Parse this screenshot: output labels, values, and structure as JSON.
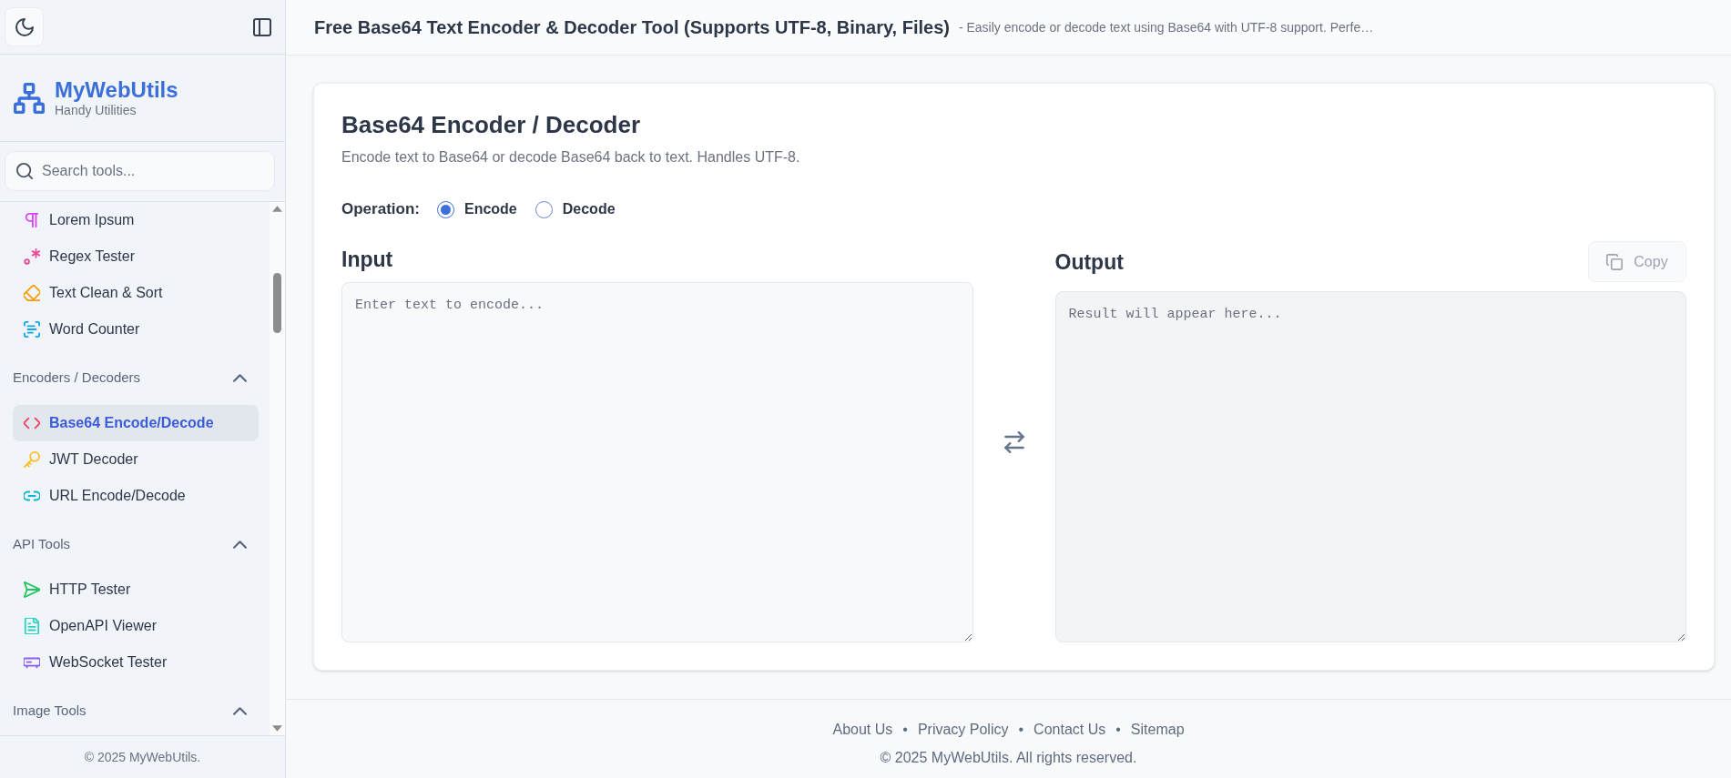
{
  "sidebar": {
    "brand": {
      "name": "MyWebUtils",
      "tagline": "Handy Utilities"
    },
    "search": {
      "placeholder": "Search tools..."
    },
    "groups": [
      {
        "items": [
          {
            "label": "Lorem Ipsum",
            "color": "#d946ef",
            "selected": false
          },
          {
            "label": "Regex Tester",
            "color": "#ec4899",
            "selected": false
          },
          {
            "label": "Text Clean & Sort",
            "color": "#f59e0b",
            "selected": false
          },
          {
            "label": "Word Counter",
            "color": "#0ea5e9",
            "selected": false
          }
        ]
      },
      {
        "title": "Encoders / Decoders",
        "expanded": true,
        "items": [
          {
            "label": "Base64 Encode/Decode",
            "color": "#f43f5e",
            "selected": true
          },
          {
            "label": "JWT Decoder",
            "color": "#fbbf24",
            "selected": false
          },
          {
            "label": "URL Encode/Decode",
            "color": "#06b6d4",
            "selected": false
          }
        ]
      },
      {
        "title": "API Tools",
        "expanded": true,
        "items": [
          {
            "label": "HTTP Tester",
            "color": "#22c55e",
            "selected": false
          },
          {
            "label": "OpenAPI Viewer",
            "color": "#2dd4bf",
            "selected": false
          },
          {
            "label": "WebSocket Tester",
            "color": "#8b5cf6",
            "selected": false
          }
        ]
      },
      {
        "title": "Image Tools",
        "expanded": true
      }
    ],
    "footer": "© 2025 MyWebUtils."
  },
  "header": {
    "title": "Free Base64 Text Encoder & Decoder Tool (Supports UTF-8, Binary, Files)",
    "subtitle": "- Easily encode or decode text using Base64 with UTF-8 support. Perfe…"
  },
  "tool": {
    "title": "Base64 Encoder / Decoder",
    "description": "Encode text to Base64 or decode Base64 back to text. Handles UTF-8.",
    "operation": {
      "label": "Operation:",
      "options": [
        {
          "label": "Encode",
          "selected": true
        },
        {
          "label": "Decode",
          "selected": false
        }
      ]
    },
    "input": {
      "label": "Input",
      "placeholder": "Enter text to encode..."
    },
    "output": {
      "label": "Output",
      "placeholder": "Result will appear here...",
      "copy_button": {
        "label": "Copy",
        "disabled": true
      }
    }
  },
  "footer": {
    "links": [
      "About Us",
      "Privacy Policy",
      "Contact Us",
      "Sitemap"
    ],
    "separator": "•",
    "copyright": "© 2025 MyWebUtils. All rights reserved."
  }
}
